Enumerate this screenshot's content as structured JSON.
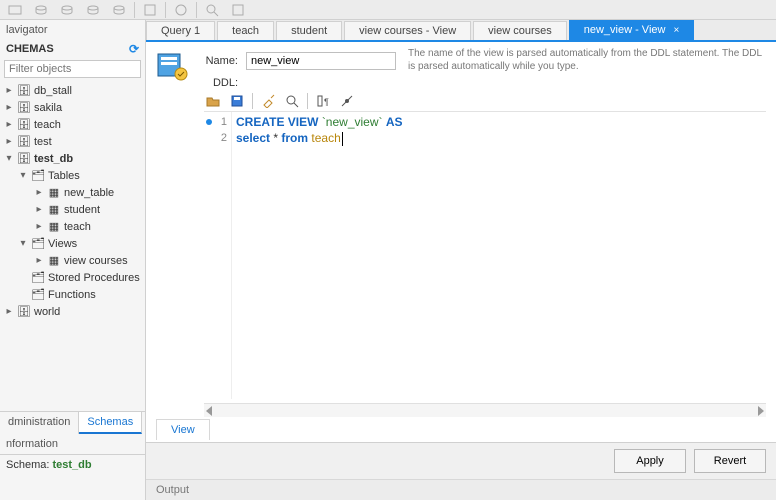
{
  "navigator_title": "lavigator",
  "schemas_title": "CHEMAS",
  "filter_placeholder": "Filter objects",
  "tree": {
    "databases": [
      "db_stall",
      "sakila",
      "teach",
      "test"
    ],
    "current_db": "test_db",
    "tables_label": "Tables",
    "tables": [
      "new_table",
      "student",
      "teach"
    ],
    "views_label": "Views",
    "views": [
      "view courses"
    ],
    "sp_label": "Stored Procedures",
    "fn_label": "Functions",
    "after_db": "world"
  },
  "left_tabs": {
    "admin": "dministration",
    "schemas": "Schemas"
  },
  "info_title": "nformation",
  "schema_line_label": "Schema: ",
  "schema_line_name": "test_db",
  "query_tabs": [
    {
      "label": "Query 1"
    },
    {
      "label": "teach"
    },
    {
      "label": "student"
    },
    {
      "label": "view courses - View"
    },
    {
      "label": "view courses"
    },
    {
      "label": "new_view - View",
      "active": true,
      "closable": true
    }
  ],
  "form": {
    "name_label": "Name:",
    "name_value": "new_view",
    "ddl_label": "DDL:",
    "hint": "The name of the view is parsed automatically from the DDL statement. The DDL is parsed automatically while you type."
  },
  "code": {
    "lines": [
      {
        "n": "1",
        "html": "<span class='kw'>CREATE</span> <span class='kw'>VIEW</span> <span class='str'>`new_view`</span> <span class='kw'>AS</span>"
      },
      {
        "n": "2",
        "html": "<span class='kw'>select</span> * <span class='kw'>from</span> <span class='ident'>teach</span><span class='cursor'></span>"
      }
    ]
  },
  "view_tab": "View",
  "apply": "Apply",
  "revert": "Revert",
  "output": "Output"
}
